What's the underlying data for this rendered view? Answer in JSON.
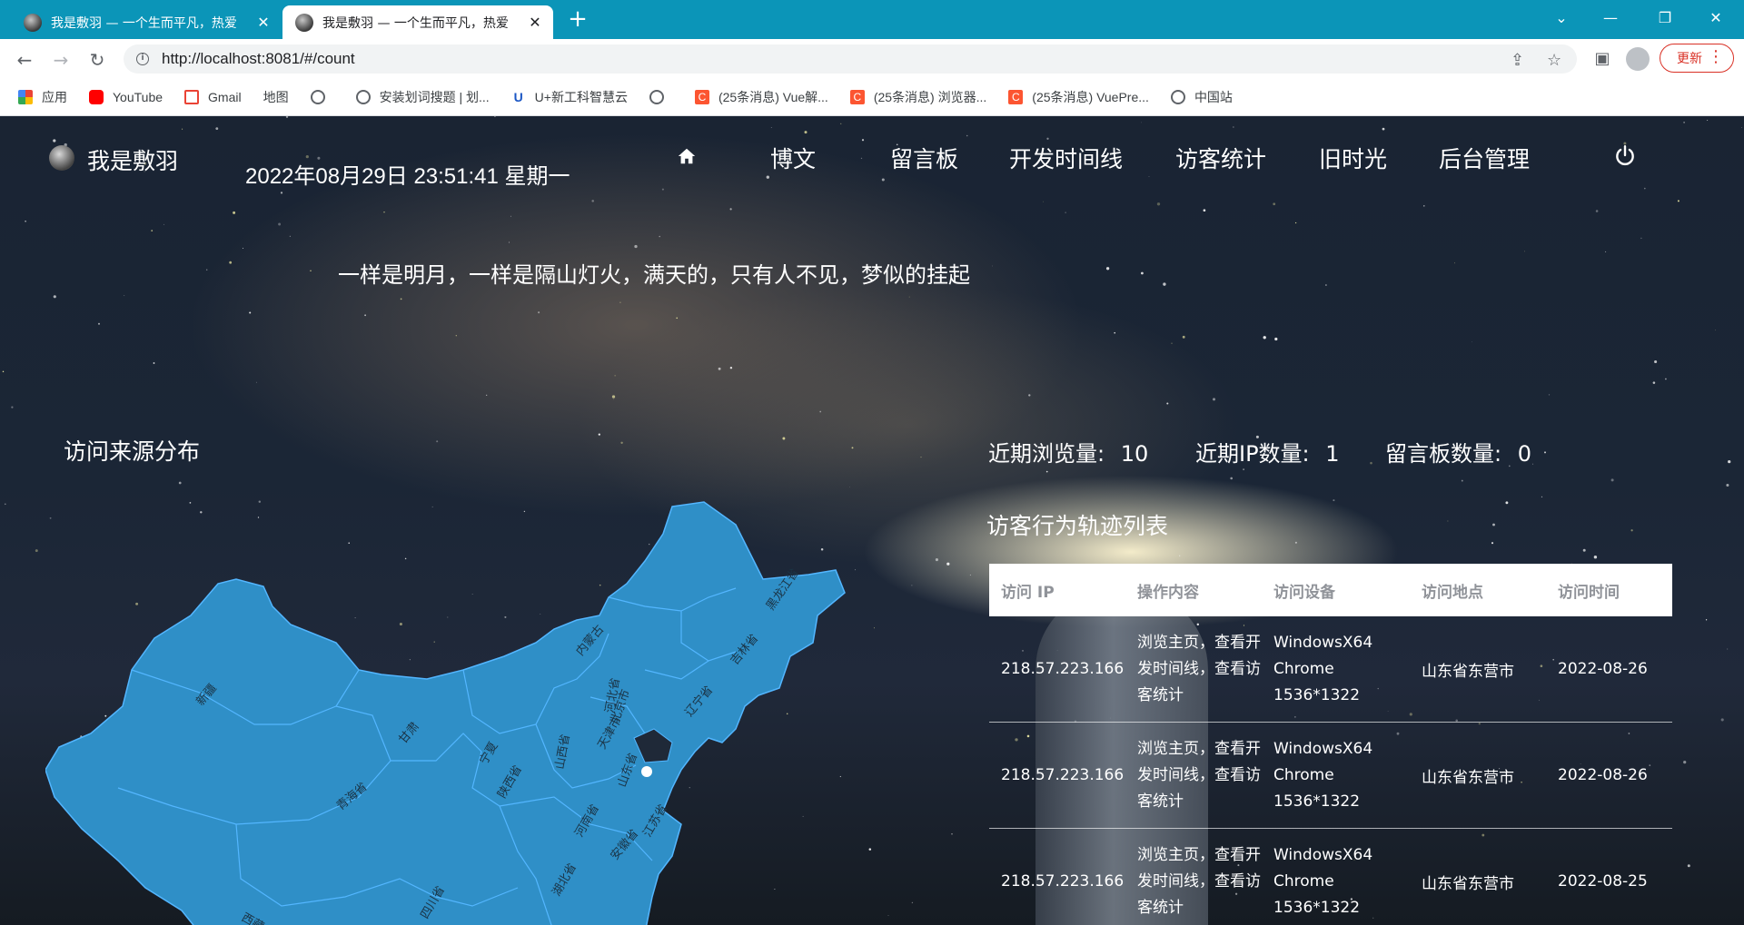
{
  "browser": {
    "tabs": [
      {
        "title": "我是敷羽 — 一个生而平凡，热爱",
        "active": false
      },
      {
        "title": "我是敷羽 — 一个生而平凡，热爱",
        "active": true
      }
    ],
    "url": "http://localhost:8081/#/count",
    "update_label": "更新",
    "bookmarks": [
      {
        "label": "应用",
        "icon": "apps-grid-icon"
      },
      {
        "label": "YouTube",
        "icon": "youtube-icon"
      },
      {
        "label": "Gmail",
        "icon": "gmail-icon"
      },
      {
        "label": "地图",
        "icon": "maps-icon"
      },
      {
        "label": "",
        "icon": "globe-icon"
      },
      {
        "label": "安装划词搜题 | 划...",
        "icon": "globe-icon"
      },
      {
        "label": "U+新工科智慧云",
        "icon": "u-plus-icon"
      },
      {
        "label": "",
        "icon": "globe-icon"
      },
      {
        "label": "(25条消息) Vue解...",
        "icon": "csdn-icon"
      },
      {
        "label": "(25条消息) 浏览器...",
        "icon": "csdn-icon"
      },
      {
        "label": "(25条消息) VuePre...",
        "icon": "csdn-icon"
      },
      {
        "label": "中国站",
        "icon": "globe-icon"
      }
    ]
  },
  "site": {
    "logo_text": "我是敷羽",
    "datetime": "2022年08月29日 23:51:41 星期一",
    "nav": [
      "博文",
      "留言板",
      "开发时间线",
      "访客统计",
      "旧时光",
      "后台管理"
    ],
    "motto": "一样是明月，一样是隔山灯火，满天的，只有人不见，梦似的挂起"
  },
  "stats": {
    "map_title": "访问来源分布",
    "views_label": "近期浏览量:",
    "views_value": "10",
    "ip_label": "近期IP数量:",
    "ip_value": "1",
    "board_label": "留言板数量:",
    "board_value": "0"
  },
  "visitor_table": {
    "title": "访客行为轨迹列表",
    "headers": [
      "访问 IP",
      "操作内容",
      "访问设备",
      "访问地点",
      "访问时间"
    ],
    "rows": [
      [
        "218.57.223.166",
        "浏览主页，查看开发时间线，查看访客统计",
        "WindowsX64 Chrome 1536*1322",
        "山东省东营市",
        "2022-08-26"
      ],
      [
        "218.57.223.166",
        "浏览主页，查看开发时间线，查看访客统计",
        "WindowsX64 Chrome 1536*1322",
        "山东省东营市",
        "2022-08-26"
      ],
      [
        "218.57.223.166",
        "浏览主页，查看开发时间线，查看访客统计",
        "WindowsX64 Chrome 1536*1322",
        "山东省东营市",
        "2022-08-25"
      ]
    ]
  },
  "map": {
    "fill_color": "#2f8fc7",
    "border_color": "#53b6ff",
    "labels": [
      "新疆",
      "西藏",
      "青海省",
      "甘肃",
      "内蒙古",
      "黑龙江省",
      "吉林省",
      "辽宁省",
      "北京市",
      "天津市",
      "河北省",
      "山西省",
      "宁夏",
      "陕西省",
      "山东省",
      "河南省",
      "江苏省",
      "安徽省",
      "湖北省",
      "四川省"
    ]
  }
}
